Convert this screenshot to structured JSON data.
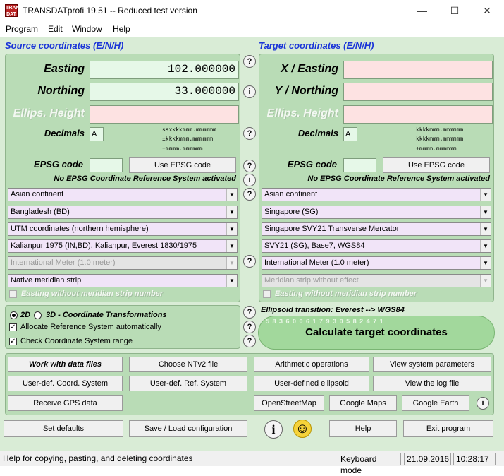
{
  "window": {
    "title": "TRANSDATprofi 19.51 -- Reduced test version",
    "app_icon_text": "TRANS DAT",
    "minimize": "—",
    "maximize": "☐",
    "close": "✕"
  },
  "menu": [
    "Program",
    "Edit",
    "Window",
    "Help"
  ],
  "source": {
    "title": "Source coordinates (E/N/H)",
    "easting_label": "Easting",
    "easting_value": "102.000000",
    "northing_label": "Northing",
    "northing_value": "33.000000",
    "height_label": "Ellips. Height",
    "decimals_label": "Decimals",
    "decimals_value": "A",
    "format_lines": [
      "ssxkkkmmm.mmmmmm",
      "±kkkkmmm.mmmmmm",
      "±mmmm.mmmmmm"
    ],
    "epsg_label": "EPSG code",
    "epsg_button": "Use EPSG code",
    "epsg_info": "No EPSG Coordinate Reference System activated",
    "selects": [
      "Asian continent",
      "Bangladesh (BD)",
      "UTM coordinates (northern hemisphere)",
      "Kalianpur 1975 (IN,BD), Kalianpur, Everest 1830/1975",
      "International Meter (1.0 meter)",
      "Native meridian strip"
    ],
    "strip_checkbox": "Easting without meridian strip number"
  },
  "target": {
    "title": "Target coordinates (E/N/H)",
    "x_label": "X / Easting",
    "y_label": "Y / Northing",
    "height_label": "Ellips. Height",
    "decimals_label": "Decimals",
    "decimals_value": "A",
    "format_lines": [
      "kkkkmmm.mmmmmm",
      "kkkkmmm.mmmmmm",
      "±mmmm.mmmmmm"
    ],
    "epsg_label": "EPSG code",
    "epsg_button": "Use EPSG code",
    "epsg_info": "No EPSG Coordinate Reference System activated",
    "selects": [
      "Asian continent",
      "Singapore (SG)",
      "Singapore SVY21 Transverse Mercator",
      "SVY21 (SG), Base7, WGS84",
      "International Meter (1.0 meter)",
      "Meridian strip without effect"
    ],
    "strip_checkbox": "Easting without meridian strip number"
  },
  "options": {
    "radio_2d": "2D",
    "radio_3d": "3D - Coordinate Transformations",
    "allocate": "Allocate Reference System automatically",
    "check_range": "Check Coordinate System range"
  },
  "ellipsoid_transition": "Ellipsoid transition: Everest --> WGS84",
  "calc_button": "Calculate target coordinates",
  "calc_digits": "5 8 3 6 0 0 6 1 7 9 3 0 5 8 2 4 7 1",
  "buttons": {
    "work_files": "Work with data files",
    "ntv2": "Choose NTv2 file",
    "arithmetic": "Arithmetic operations",
    "view_params": "View system parameters",
    "user_coord": "User-def. Coord. System",
    "user_ref": "User-def. Ref. System",
    "user_ellipsoid": "User-defined ellipsoid",
    "view_log": "View the log file",
    "gps": "Receive GPS data",
    "osm": "OpenStreetMap",
    "google_maps": "Google Maps",
    "google_earth": "Google Earth",
    "set_defaults": "Set defaults",
    "save_load": "Save / Load configuration",
    "help": "Help",
    "exit": "Exit program"
  },
  "icons": {
    "question": "?",
    "info": "i",
    "smiley": "☺"
  },
  "status": {
    "help_text": "Help for copying, pasting, and deleting coordinates",
    "keyboard_mode": "Keyboard mode",
    "date": "21.09.2016",
    "time": "10:28:17"
  },
  "colors": {
    "section_title": "#1b35d8",
    "panel_bg": "#b9dcb6",
    "input_green": "#e6f8e8",
    "input_pink": "#fde2e2",
    "select_lilac": "#f1e4f8",
    "calc_button": "#a2d89c"
  }
}
